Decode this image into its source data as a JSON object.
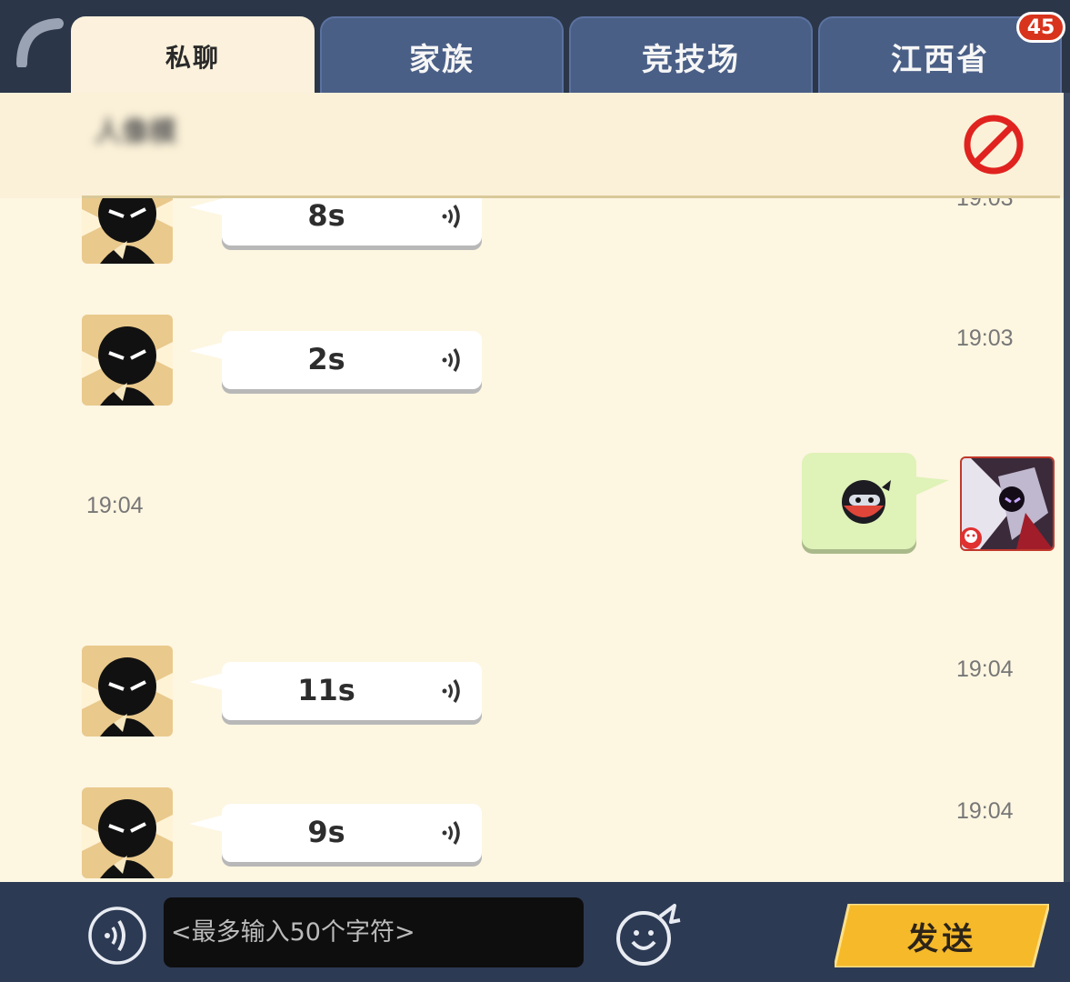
{
  "tabs": [
    {
      "label": "私聊",
      "active": true
    },
    {
      "label": "家族",
      "active": false
    },
    {
      "label": "竞技场",
      "active": false
    },
    {
      "label": "江西省",
      "active": false
    }
  ],
  "badge": "45",
  "conversation": {
    "contact_name": "人像模"
  },
  "messages": [
    {
      "side": "left",
      "type": "voice",
      "duration": "8s",
      "time": "19:03"
    },
    {
      "side": "left",
      "type": "voice",
      "duration": "2s",
      "time": "19:03"
    },
    {
      "side": "right",
      "type": "emoji",
      "time": "19:04"
    },
    {
      "side": "left",
      "type": "voice",
      "duration": "11s",
      "time": "19:04"
    },
    {
      "side": "left",
      "type": "voice",
      "duration": "9s",
      "time": "19:04"
    }
  ],
  "input": {
    "placeholder": "<最多输入50个字符>"
  },
  "send_label": "发送",
  "colors": {
    "panel_bg": "#fdf6e1",
    "tab_blue": "#4a5f86",
    "send_yellow": "#f5b92a",
    "badge_red": "#d8331c",
    "emoji_bubble": "#dff2b8"
  }
}
